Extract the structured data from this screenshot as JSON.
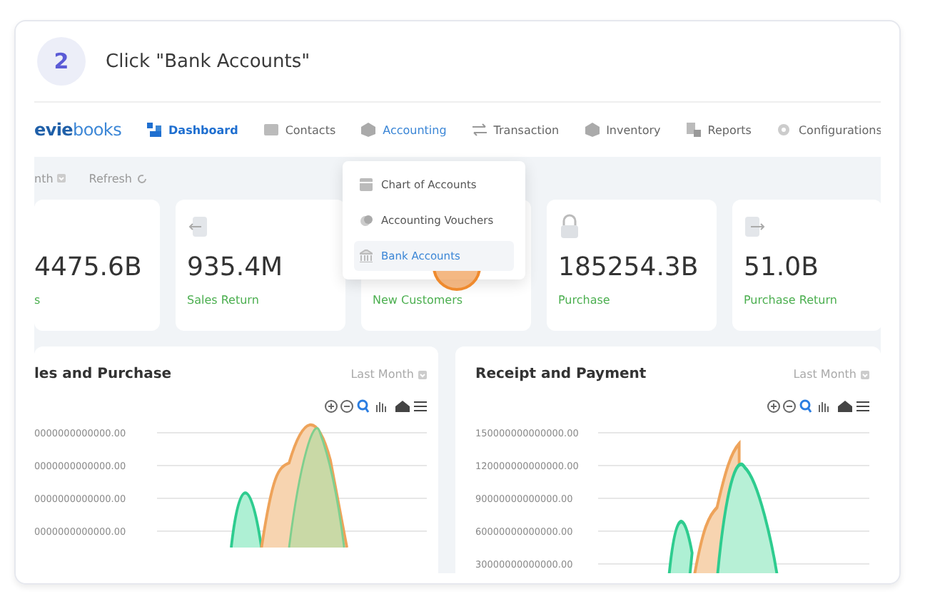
{
  "step": {
    "number": "2",
    "instruction": "Click \"Bank Accounts\""
  },
  "app": {
    "logo": {
      "part_1": "evie",
      "part_2": "books"
    },
    "nav": [
      {
        "label": "Dashboard",
        "selected": true,
        "expanded": false
      },
      {
        "label": "Contacts",
        "selected": false,
        "expanded": false
      },
      {
        "label": "Accounting",
        "selected": false,
        "expanded": true
      },
      {
        "label": "Transaction",
        "selected": false,
        "expanded": false
      },
      {
        "label": "Inventory",
        "selected": false,
        "expanded": false
      },
      {
        "label": "Reports",
        "selected": false,
        "expanded": false
      },
      {
        "label": "Configurations",
        "selected": false,
        "expanded": false
      }
    ],
    "filters": [
      {
        "label": "nth"
      },
      {
        "label": "Refresh"
      }
    ],
    "menu": [
      {
        "label": "Chart of Accounts",
        "selected": false
      },
      {
        "label": "Accounting Vouchers",
        "selected": false
      },
      {
        "label": "Bank Accounts",
        "selected": true
      }
    ],
    "stats": [
      {
        "value": "4475.6B",
        "label": "s"
      },
      {
        "value": "935.4M",
        "label": "Sales Return"
      },
      {
        "label": "New Customers"
      },
      {
        "value": "185254.3B",
        "label": "Purchase"
      },
      {
        "value": "51.0B",
        "label": "Purchase Return"
      }
    ],
    "charts": [
      {
        "title": "les and Purchase",
        "period": "Last Month",
        "y_labels": [
          "0000000000000.00",
          "0000000000000.00",
          "0000000000000.00",
          "0000000000000.00"
        ]
      },
      {
        "title": "Receipt and Payment",
        "period": "Last Month",
        "y_labels": [
          "150000000000000.00",
          "120000000000000.00",
          "90000000000000.00",
          "60000000000000.00",
          "30000000000000.00"
        ]
      }
    ]
  }
}
